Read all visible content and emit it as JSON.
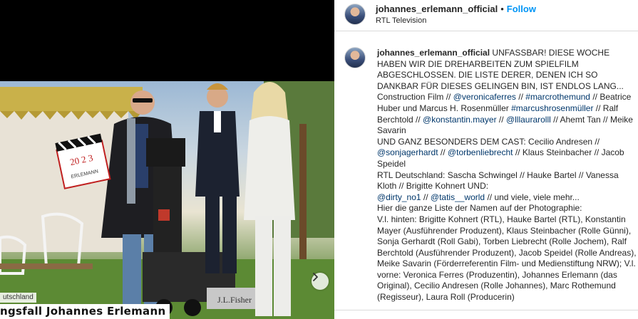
{
  "media": {
    "caption_tag": "utschland",
    "caption_title": "ngsfall Johannes Erlemann",
    "clapper_text": "20 2 3",
    "clapper_sub": "ERLEMANN",
    "camera_brand": "J.L.Fisher"
  },
  "header": {
    "username": "johannes_erlemann_official",
    "separator": "•",
    "follow_label": "Follow",
    "location": "RTL Television"
  },
  "caption": {
    "username": "johannes_erlemann_official",
    "p1": "UNFASSBAR! DIESE WOCHE HABEN WIR DIE DREHARBEITEN ZUM SPIELFILM ABGESCHLOSSEN. DIE LISTE DERER, DENEN ICH SO DANKBAR FÜR DIESES GELINGEN BIN, IST ENDLOS LANG...",
    "p2": "Construction Film // ",
    "m1": "@veronicaferres",
    "p3": " // ",
    "m2": "#marcrothemund",
    "p4": " // Beatrice Huber und Marcus H. Rosenmüller ",
    "m3": "#marcushrosenmüller",
    "p5": " // Ralf Berchtold // ",
    "m4": "@konstantin.mayer",
    "p6": " // ",
    "m5": "@lllaurarolll",
    "p7": " // Ahemt Tan // Meike Savarin",
    "p8": "UND GANZ BESONDERS DEM CAST: Cecilio Andresen // ",
    "m6": "@sonjagerhardt",
    "p9": " // ",
    "m7": "@torbenliebrecht",
    "p10": " // Klaus Steinbacher // Jacob Speidel",
    "p11": "RTL Deutschland: Sascha Schwingel // Hauke Bartel // Vanessa Kloth // Brigitte Kohnert UND:",
    "m8": "@dirty_no1",
    "p12": " // ",
    "m9": "@tatis__world",
    "p13": " // und viele, viele mehr...",
    "p14": "Hier die ganze Liste der Namen auf der Photographie:",
    "p15": "V.l. hinten: Brigitte Kohnert (RTL), Hauke Bartel (RTL), Konstantin Mayer (Ausführender Produzent), Klaus Steinbacher (Rolle Günni), Sonja Gerhardt (Roll Gabi), Torben Liebrecht (Rolle Jochem), Ralf Berchtold (Ausführender Produzent), Jacob Speidel (Rolle Andreas), Meike Savarin (Förderreferentin Film- und Medienstiftung NRW); V.l. vorne: Veronica Ferres (Produzentin), Johannes Erlemann (das Original), Cecilio Andresen (Rolle Johannes), Marc Rothemund (Regisseur), Laura Roll (Producerin)"
  },
  "icons": {
    "next": "chevron-right-icon"
  },
  "colors": {
    "link_blue": "#0095f6",
    "mention": "#00376b",
    "text": "#262626",
    "divider": "#dbdbdb"
  }
}
